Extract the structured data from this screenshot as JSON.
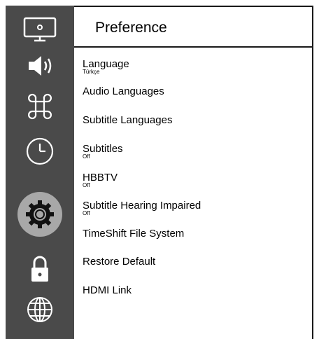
{
  "header": {
    "title": "Preference"
  },
  "sidebar": {
    "items": [
      {
        "icon": "tv-settings-icon"
      },
      {
        "icon": "speaker-icon"
      },
      {
        "icon": "command-icon"
      },
      {
        "icon": "clock-icon"
      },
      {
        "icon": "gear-icon",
        "selected": true
      },
      {
        "icon": "lock-icon"
      },
      {
        "icon": "globe-icon"
      }
    ]
  },
  "menu": {
    "items": [
      {
        "label": "Language",
        "value": "Türkçe"
      },
      {
        "label": "Audio Languages",
        "value": ""
      },
      {
        "label": "Subtitle Languages",
        "value": ""
      },
      {
        "label": "Subtitles",
        "value": "Off"
      },
      {
        "label": "HBBTV",
        "value": "Off"
      },
      {
        "label": "Subtitle Hearing Impaired",
        "value": "Off"
      },
      {
        "label": "TimeShift File System",
        "value": ""
      },
      {
        "label": "Restore Default",
        "value": ""
      },
      {
        "label": "HDMI Link",
        "value": ""
      }
    ]
  },
  "colors": {
    "sidebar_bg": "#4a4a4a",
    "selected_bg": "#a8a8a8",
    "text": "#000000",
    "background": "#ffffff"
  }
}
